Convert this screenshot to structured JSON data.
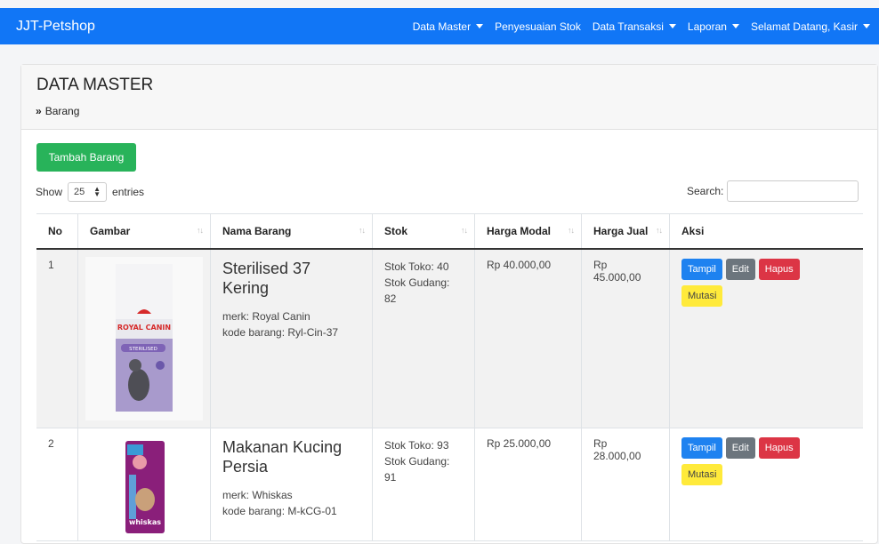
{
  "navbar": {
    "brand": "JJT-Petshop",
    "items": [
      {
        "label": "Data Master",
        "dropdown": true
      },
      {
        "label": "Penyesuaian Stok",
        "dropdown": false
      },
      {
        "label": "Data Transaksi",
        "dropdown": true
      },
      {
        "label": "Laporan",
        "dropdown": true
      },
      {
        "label": "Selamat Datang, Kasir",
        "dropdown": true
      }
    ]
  },
  "header": {
    "title": "DATA MASTER",
    "breadcrumb_icon": "»",
    "breadcrumb": "Barang"
  },
  "toolbar": {
    "add_label": "Tambah Barang",
    "show_label": "Show",
    "entries_value": "25",
    "entries_label": "entries",
    "search_label": "Search:",
    "search_value": ""
  },
  "table": {
    "headers": [
      "No",
      "Gambar",
      "Nama Barang",
      "Stok",
      "Harga Modal",
      "Harga Jual",
      "Aksi"
    ],
    "rows": [
      {
        "no": "1",
        "name": "Sterilised 37 Kering",
        "merk": "merk: Royal Canin",
        "kode": "kode barang: Ryl-Cin-37",
        "stok_toko": "Stok Toko: 40",
        "stok_gudang": "Stok Gudang: 82",
        "harga_modal": "Rp 40.000,00",
        "harga_jual": "Rp 45.000,00",
        "image_logo": "ROYAL CANIN",
        "image_variant": "STERILISED"
      },
      {
        "no": "2",
        "name": "Makanan Kucing Persia",
        "merk": "merk: Whiskas",
        "kode": "kode barang: M-kCG-01",
        "stok_toko": "Stok Toko: 93",
        "stok_gudang": "Stok Gudang: 91",
        "harga_modal": "Rp 25.000,00",
        "harga_jual": "Rp 28.000,00",
        "image_logo": "whiskas",
        "image_variant": ""
      }
    ],
    "actions": {
      "tampil": "Tampil",
      "edit": "Edit",
      "hapus": "Hapus",
      "mutasi": "Mutasi"
    }
  },
  "colors": {
    "navbar": "#1176f6",
    "add_button": "#28b35a",
    "tampil": "#1e82f0",
    "edit": "#6c757d",
    "hapus": "#dc3545",
    "mutasi": "#ffea3b"
  }
}
